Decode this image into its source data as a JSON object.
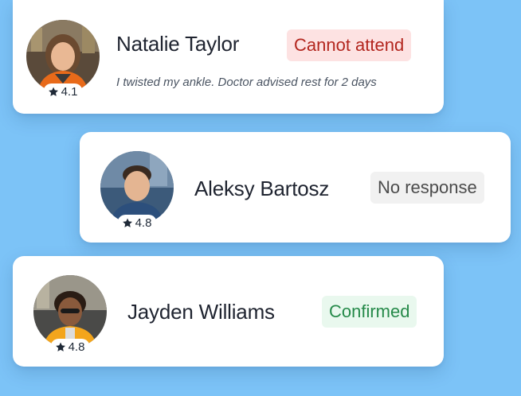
{
  "colors": {
    "background": "#7cc3f7",
    "cannot_attend": "#b3261e",
    "no_response": "#4b4b4b",
    "confirmed": "#268a4a"
  },
  "attendees": [
    {
      "name": "Natalie Taylor",
      "rating": "4.1",
      "status": "Cannot attend",
      "status_color": "red",
      "note": "I twisted my ankle. Doctor advised rest for 2 days"
    },
    {
      "name": "Aleksy Bartosz",
      "rating": "4.8",
      "status": "No response",
      "status_color": "gray"
    },
    {
      "name": "Jayden Williams",
      "rating": "4.8",
      "status": "Confirmed",
      "status_color": "green"
    }
  ]
}
